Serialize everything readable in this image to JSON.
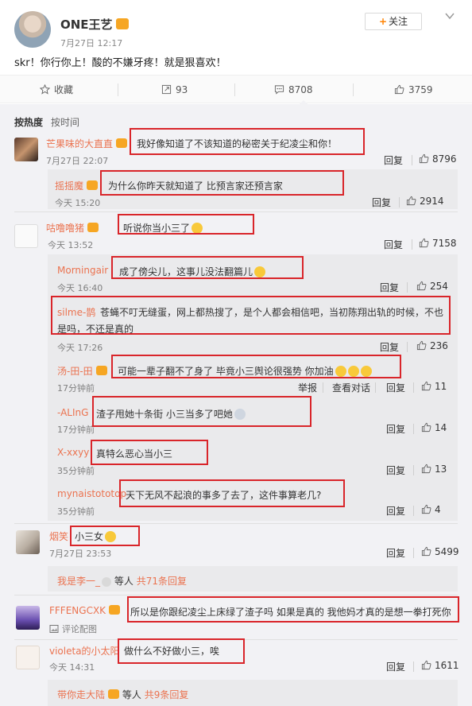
{
  "post": {
    "author": "ONE王艺",
    "time": "7月27日 12:17",
    "text": "skr！你行你上！酸的不嫌牙疼！就是狠喜欢！",
    "follow_label": "关注"
  },
  "actions": {
    "favorite": "收藏",
    "repost_count": "93",
    "comment_count": "8708",
    "like_count": "3759"
  },
  "sort": {
    "hot": "按热度",
    "time": "按时间"
  },
  "reply_label": "回复",
  "comments": [
    {
      "user": "芒果味的大直直",
      "text": "我好像知道了不该知道的秘密关于纪凌尘和你！",
      "time": "7月27日 22:07",
      "likes": "8796",
      "replies": [
        {
          "user": "摇摇魔",
          "text": "为什么你昨天就知道了 比预言家还预言家",
          "time": "今天 15:20",
          "likes": "2914"
        }
      ]
    },
    {
      "user": "咕噜噜猪",
      "text": "听说你当小三了",
      "time": "今天 13:52",
      "likes": "7158",
      "replies": [
        {
          "user": "Morningair",
          "text": "成了傍尖儿，这事儿没法翻篇儿",
          "time": "今天 16:40",
          "likes": "254"
        },
        {
          "user": "silme-鹊",
          "text": "苍蝇不叮无缝蛋，网上都热搜了，是个人都会相信吧，当初陈翔出轨的时候，不也",
          "text2": "是吗，不还是真的",
          "time": "今天 17:26",
          "likes": "236"
        },
        {
          "user": "汤-田-田",
          "text": "可能一辈子翻不了身了 毕竟小三舆论很强势 你加油",
          "time": "17分钟前",
          "likes": "11",
          "extra1": "举报",
          "extra2": "查看对话"
        },
        {
          "user": "-ALInG",
          "text": "渣子甩她十条街 小三当多了吧她",
          "time": "17分钟前",
          "likes": "14"
        },
        {
          "user": "X-xxyy",
          "text": "真特么恶心当小三",
          "time": "35分钟前",
          "likes": "13"
        },
        {
          "user": "mynaistototop",
          "text": "天下无风不起浪的事多了去了，这件事算老几?",
          "time": "35分钟前",
          "likes": "4"
        }
      ]
    },
    {
      "user": "烟笑",
      "text": "小三女",
      "time": "7月27日 23:53",
      "likes": "5499",
      "more_user": "我是李一_",
      "more_mid": "等人",
      "more_count": "共71条回复"
    },
    {
      "user": "FFFENGCXK",
      "text": "所以是你跟纪凌尘上床绿了渣子吗 如果是真的 我他妈才真的是想一拳打死你",
      "time_label": "评论配图"
    },
    {
      "user": "violeta的小太阳",
      "text": "做什么不好做小三，唉",
      "time": "今天 14:31",
      "likes": "1611",
      "more_user": "带你走大陆",
      "more_mid": "等人",
      "more_count": "共9条回复"
    }
  ],
  "colors": {
    "username": "#eb7350",
    "highlight_box": "#d9252a",
    "follow_plus": "#ff8200"
  }
}
